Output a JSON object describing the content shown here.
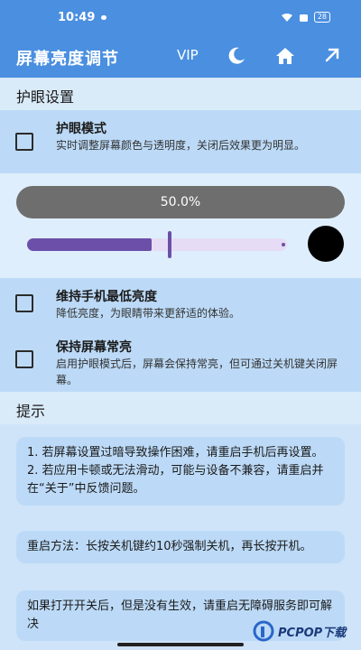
{
  "status_bar": {
    "time": "10:49",
    "battery": "28"
  },
  "app_bar": {
    "title": "屏幕亮度调节",
    "vip": "VIP"
  },
  "eye_section": {
    "title": "护眼设置",
    "eye_mode": {
      "title": "护眼模式",
      "desc": "实时调整屏幕颜色与透明度，关闭后效果更为明显。"
    },
    "brightness": {
      "percent_label": "50.0%",
      "level": 0.5
    },
    "min_brightness": {
      "title": "维持手机最低亮度",
      "desc": "降低亮度，为眼睛带来更舒适的体验。"
    },
    "keep_on": {
      "title": "保持屏幕常亮",
      "desc": "启用护眼模式后，屏幕会保持常亮，但可通过关机键关闭屏幕。"
    }
  },
  "tips_section": {
    "title": "提示",
    "card1": {
      "line1": "1. 若屏幕设置过暗导致操作困难，请重启手机后再设置。",
      "line2": "2. 若应用卡顿或无法滑动，可能与设备不兼容，请重启并在“关于”中反馈问题。"
    },
    "card2": {
      "text": "重启方法：长按关机键约10秒强制关机，再长按开机。"
    },
    "card3": {
      "text": "如果打开开关后，但是没有生效，请重启无障碍服务即可解决"
    }
  },
  "watermark": {
    "text": "PCPOP下载"
  },
  "colors": {
    "primary": "#4a8fe0",
    "slider": "#6b4fa8",
    "panel": "#bcdaf7"
  }
}
